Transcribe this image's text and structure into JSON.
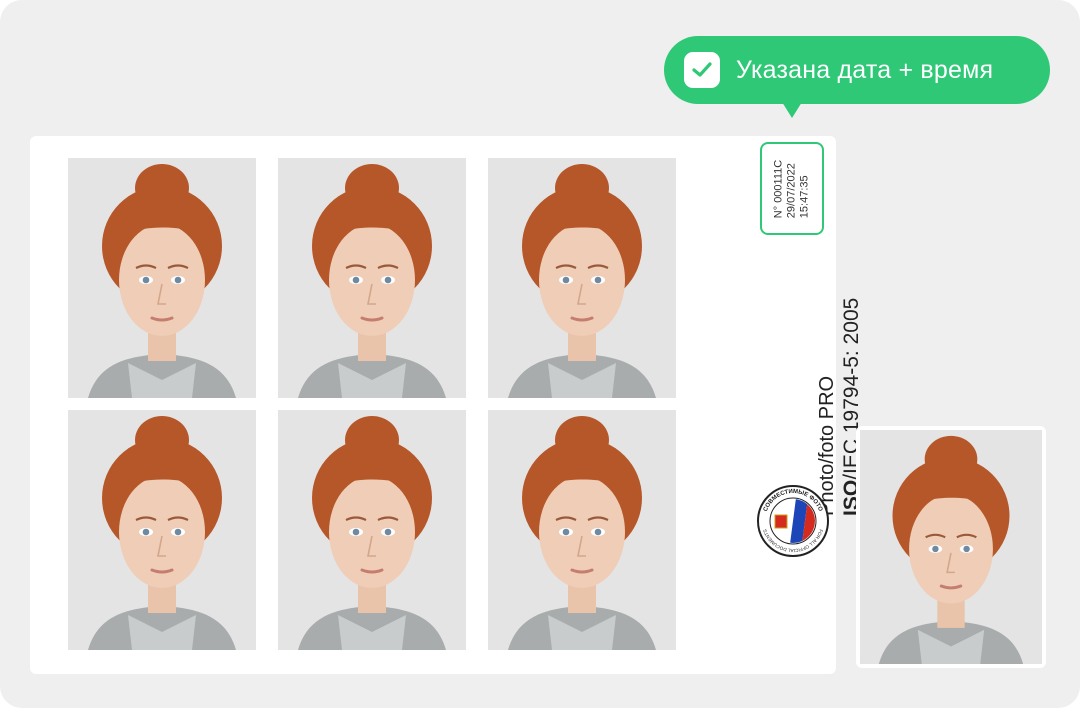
{
  "badge": {
    "text": "Указана дата + время",
    "color": "#2fc877"
  },
  "stamp": {
    "number": "N° 000111C",
    "date": "29/07/2022",
    "time": "15:47:35"
  },
  "brand": {
    "name": "Photo/foto PRO",
    "standard_prefix": "ISO",
    "standard_rest": "/IEC 19794-5: 2005"
  },
  "seal": {
    "top_text": "СОВМЕСТИМЫЕ ФОТО",
    "bottom_text": "FOR ALL OFFICIAL DOCUMENTS",
    "flag_colors": [
      "#ffffff",
      "#1c46b7",
      "#d52b1e"
    ]
  },
  "photos": {
    "count": 6,
    "hair_color": "#b6572a",
    "background": "#e4e4e4"
  },
  "icons": {
    "check": "check-icon"
  }
}
